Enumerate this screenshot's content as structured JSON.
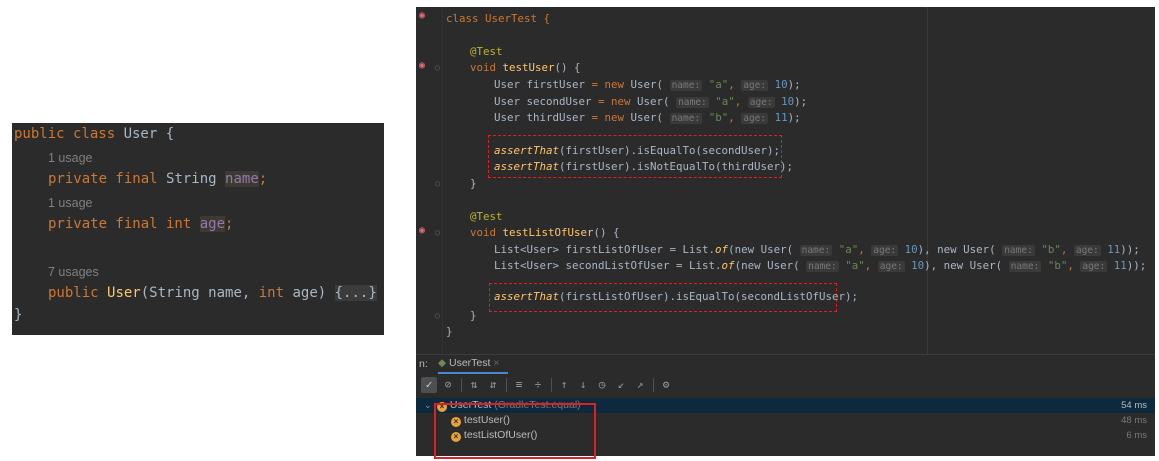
{
  "left_code": {
    "class_kw": "public class ",
    "class_name": "User",
    "class_brace": " {",
    "usage1": "1 usage",
    "field1_kw": "private final ",
    "field1_type": "String ",
    "field1_name": "name",
    "semi": ";",
    "usage2": "1 usage",
    "field2_kw": "private final int ",
    "field2_name": "age",
    "usage3": "7 usages",
    "ctor_kw": "public ",
    "ctor_name": "User",
    "ctor_p1": "(String name, ",
    "ctor_p2kw": "int",
    "ctor_p3": " age) ",
    "ctor_fold": "{...}",
    "close": "}"
  },
  "right_code": {
    "class_decl": "class UserTest {",
    "test_ann": "@Test",
    "void_kw": "void ",
    "m1_name": "testUser",
    "m2_name": "testListOfUser",
    "paren_open": "() {",
    "user_t": "User ",
    "eq_new": " = new ",
    "user_call": "User(",
    "h_name": "name:",
    "h_age": "age:",
    "v_a": "\"a\"",
    "v_b": "\"b\"",
    "comma": ", ",
    "n10": "10",
    "n11": "11",
    "close_stmt": ");",
    "var1": "firstUser",
    "var2": "secondUser",
    "var3": "thirdUser",
    "assertThat": "assertThat",
    "a1_rest": "(firstUser).isEqualTo(secondUser);",
    "a2_rest": "(firstUser).isNotEqualTo(thirdUser);",
    "close_brace": "}",
    "list_t": "List<User> ",
    "lvar1": "firstListOfUser",
    "lvar2": "secondListOfUser",
    "list_of_pre": " = List.",
    "of": "of",
    "new_user": "(new User(",
    "new_user2": "), new User(",
    "close_list": "));",
    "a3_rest": "(firstListOfUser).isEqualTo(secondListOfUser);"
  },
  "run": {
    "label": "n:",
    "tab_name": "UserTest",
    "tab_close": "×",
    "toolbar_icons": [
      "check-icon",
      "stop-icon",
      "sort-alpha-icon",
      "sort-duration-icon",
      "expand-all-icon",
      "collapse-all-icon",
      "prev-icon",
      "next-icon",
      "history-icon",
      "import-icon",
      "export-icon",
      "settings-icon"
    ],
    "tree": [
      {
        "name": "UserTest",
        "detail": " (GradleTest.equal)",
        "duration": "54 ms",
        "status": "failed"
      },
      {
        "name": "testUser()",
        "detail": "",
        "duration": "48 ms",
        "status": "failed"
      },
      {
        "name": "testListOfUser()",
        "detail": "",
        "duration": "6 ms",
        "status": "failed"
      }
    ]
  },
  "colors": {
    "editor_bg": "#2b2b2b",
    "keyword": "#cc7832",
    "method": "#ffc66d",
    "number": "#6897bb",
    "string": "#6a8759",
    "annotation_box": "#e02020"
  }
}
